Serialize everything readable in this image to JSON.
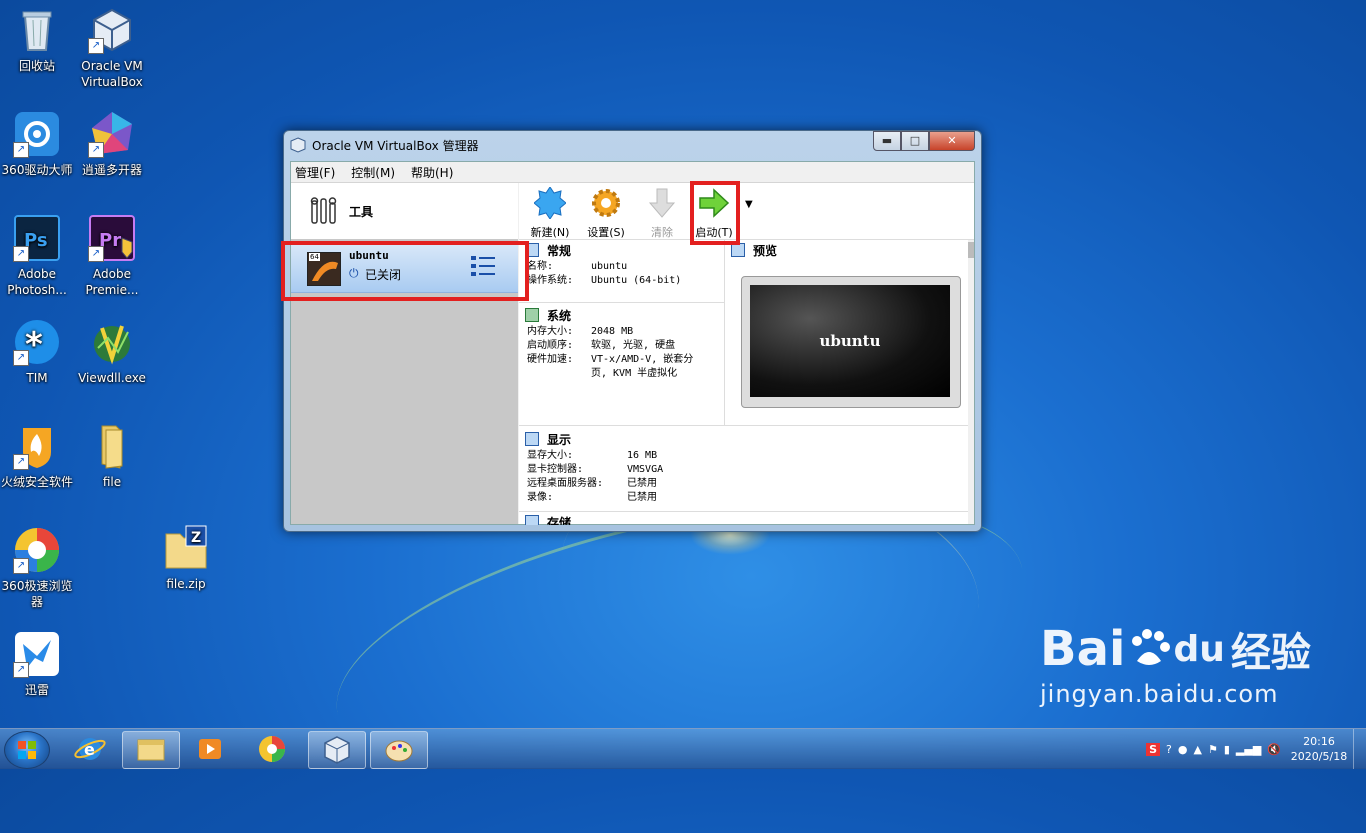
{
  "desktop": {
    "icons": [
      {
        "label": "回收站",
        "icon": "recycle-bin-icon"
      },
      {
        "label": "Oracle VM VirtualBox",
        "icon": "virtualbox-icon"
      },
      {
        "label": "360驱动大师",
        "icon": "360-driver-icon"
      },
      {
        "label": "逍遥多开器",
        "icon": "xiaoyao-icon"
      },
      {
        "label": "Adobe Photosh...",
        "icon": "photoshop-icon"
      },
      {
        "label": "Adobe Premie...",
        "icon": "premiere-icon"
      },
      {
        "label": "TIM",
        "icon": "tim-icon"
      },
      {
        "label": "Viewdll.exe",
        "icon": "viewdll-icon"
      },
      {
        "label": "火绒安全软件",
        "icon": "huorong-icon"
      },
      {
        "label": "file",
        "icon": "folder-icon"
      },
      {
        "label": "360极速浏览器",
        "icon": "360-browser-icon"
      },
      {
        "label": "file.zip",
        "icon": "zip-icon"
      },
      {
        "label": "迅雷",
        "icon": "xunlei-icon"
      }
    ]
  },
  "window": {
    "title": "Oracle VM VirtualBox 管理器",
    "buttons": {
      "minimize": "▬",
      "maximize": "□",
      "close": "✕"
    }
  },
  "menu": {
    "manage": "管理(F)",
    "control": "控制(M)",
    "help": "帮助(H)"
  },
  "left": {
    "tools_label": "工具",
    "vm": {
      "name": "ubuntu",
      "status": "已关闭",
      "badge": "64"
    }
  },
  "toolbar": {
    "new": "新建(N)",
    "settings": "设置(S)",
    "discard": "清除",
    "start": "启动(T)"
  },
  "details": {
    "general": {
      "title": "常规",
      "name_k": "名称:",
      "name_v": "ubuntu",
      "os_k": "操作系统:",
      "os_v": "Ubuntu (64-bit)"
    },
    "system": {
      "title": "系统",
      "mem_k": "内存大小:",
      "mem_v": "2048 MB",
      "boot_k": "启动顺序:",
      "boot_v": "软驱, 光驱, 硬盘",
      "accel_k": "硬件加速:",
      "accel_v1": "VT-x/AMD-V, 嵌套分",
      "accel_v2": "页, KVM 半虚拟化"
    },
    "preview": {
      "title": "预览",
      "screen_text": "ubuntu"
    },
    "display": {
      "title": "显示",
      "vram_k": "显存大小:",
      "vram_v": "16 MB",
      "ctrl_k": "显卡控制器:",
      "ctrl_v": "VMSVGA",
      "rdp_k": "远程桌面服务器:",
      "rdp_v": "已禁用",
      "rec_k": "录像:",
      "rec_v": "已禁用"
    },
    "storage": {
      "title": "存储"
    }
  },
  "taskbar": {
    "items": [
      "ie-icon",
      "explorer-icon",
      "media-icon",
      "360-browser-icon",
      "virtualbox-icon",
      "paint-icon"
    ],
    "time": "20:16",
    "date": "2020/5/18"
  },
  "watermark": {
    "brand": "Bai",
    "brand2": "du",
    "cn": "经验",
    "url": "jingyan.baidu.com"
  }
}
